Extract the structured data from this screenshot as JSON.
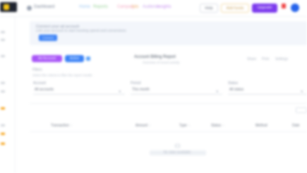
{
  "topbar": {
    "brand": "Dashboard",
    "nav": [
      "Home",
      "Reports",
      "Campaigns",
      "Ads",
      "Audience",
      "Insights"
    ],
    "btn_light": "Help",
    "btn_amber": "Add funds",
    "btn_upgrade": "Upgrade"
  },
  "banner": {
    "title": "Connect your ad account",
    "subtitle": "Link your account to start tracking spend and conversions",
    "button": "Connect"
  },
  "tags": {
    "purple": "Ad Account",
    "blue": "Active"
  },
  "page": {
    "title": "Account Billing Report",
    "subtitle": "Overview of recent activity"
  },
  "right_links": [
    "Share",
    "Print",
    "Settings"
  ],
  "section": {
    "label": "Filters",
    "desc": "Select the criteria to filter the report results"
  },
  "filters": [
    {
      "label": "Account",
      "value": "All accounts"
    },
    {
      "label": "Period",
      "value": "This month"
    },
    {
      "label": "Status",
      "value": "All status"
    }
  ],
  "table": {
    "columns": [
      "Transaction",
      "Amount",
      "Type",
      "Status",
      "Method",
      "Date"
    ]
  },
  "empty": {
    "text": "No data available"
  },
  "colors": {
    "accent": "#7c3aed",
    "primary": "#3b82f6",
    "tag_purple": "#a855f7"
  }
}
